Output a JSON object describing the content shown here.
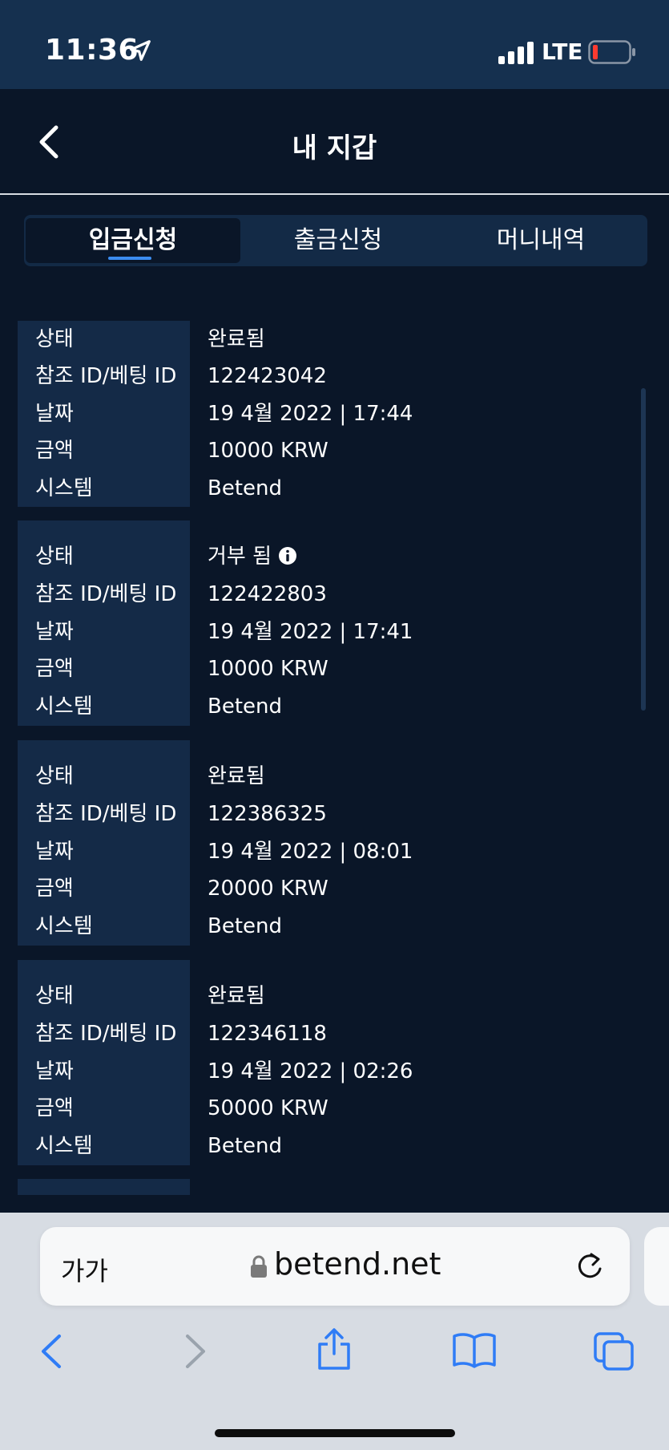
{
  "status_bar": {
    "time": "11:36",
    "network": "LTE"
  },
  "header": {
    "title": "내 지갑"
  },
  "tabs": [
    {
      "label": "입금신청",
      "active": true
    },
    {
      "label": "출금신청",
      "active": false
    },
    {
      "label": "머니내역",
      "active": false
    }
  ],
  "records": [
    {
      "status_label": "상태",
      "status": "완료됨",
      "status_info": false,
      "ref_label": "참조 ID/베팅 ID",
      "ref": "122423042",
      "date_label": "날짜",
      "date": "19 4월 2022 | 17:44",
      "amount_label": "금액",
      "amount": "10000 KRW",
      "system_label": "시스템",
      "system": "Betend"
    },
    {
      "status_label": "상태",
      "status": "거부 됨",
      "status_info": true,
      "ref_label": "참조 ID/베팅 ID",
      "ref": "122422803",
      "date_label": "날짜",
      "date": "19 4월 2022 | 17:41",
      "amount_label": "금액",
      "amount": "10000 KRW",
      "system_label": "시스템",
      "system": "Betend"
    },
    {
      "status_label": "상태",
      "status": "완료됨",
      "status_info": false,
      "ref_label": "참조 ID/베팅 ID",
      "ref": "122386325",
      "date_label": "날짜",
      "date": "19 4월 2022 | 08:01",
      "amount_label": "금액",
      "amount": "20000 KRW",
      "system_label": "시스템",
      "system": "Betend"
    },
    {
      "status_label": "상태",
      "status": "완료됨",
      "status_info": false,
      "ref_label": "참조 ID/베팅 ID",
      "ref": "122346118",
      "date_label": "날짜",
      "date": "19 4월 2022 | 02:26",
      "amount_label": "금액",
      "amount": "50000 KRW",
      "system_label": "시스템",
      "system": "Betend"
    }
  ],
  "browser": {
    "text_size_label": "가가",
    "url": "betend.net"
  },
  "colors": {
    "page_bg": "#0a1628",
    "card_label_bg": "#142a47",
    "tab_accent": "#3b8cf0",
    "safari_blue": "#2f7cf6"
  }
}
